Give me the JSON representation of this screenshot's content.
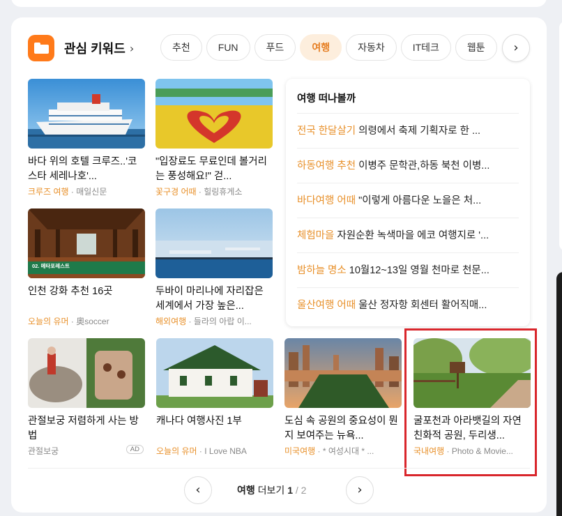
{
  "header": {
    "title": "관심 키워드",
    "chevron": "›"
  },
  "tabs": [
    {
      "label": "추천",
      "active": false
    },
    {
      "label": "FUN",
      "active": false
    },
    {
      "label": "푸드",
      "active": false
    },
    {
      "label": "여행",
      "active": true
    },
    {
      "label": "자동차",
      "active": false
    },
    {
      "label": "IT테크",
      "active": false
    },
    {
      "label": "웹툰",
      "active": false
    }
  ],
  "tabs_next": "›",
  "row1": [
    {
      "title": "바다 위의 호텔 크루즈..'코스타 세레나호'...",
      "keyword": "크루즈 여행",
      "source": "매일신문"
    },
    {
      "title": "\"입장료도 무료인데 볼거리는 풍성해요!\" 걷...",
      "keyword": "꽃구경 어때",
      "source": "힐링휴게소"
    }
  ],
  "row2": [
    {
      "title": "인천 강화 추천 16곳",
      "keyword": "오늘의 유머",
      "source": "奧soccer",
      "badge": "02. 메타포레스트"
    },
    {
      "title": "두바이 마리나에 자리잡은 세계에서 가장 높은...",
      "keyword": "해외여행",
      "source": "들라의 아랍 이..."
    }
  ],
  "travel_box": {
    "title": "여행 떠나볼까",
    "items": [
      {
        "keyword": "전국 한달살기",
        "text": "의령에서 축제 기획자로 한 ..."
      },
      {
        "keyword": "하동여행 추천",
        "text": "이병주 문학관,하동 북천 이병..."
      },
      {
        "keyword": "바다여행 어때",
        "text": "\"이렇게 아름다운 노을은 처..."
      },
      {
        "keyword": "체험마을",
        "text": "자원순환 녹색마을 에코 여행지로 '..."
      },
      {
        "keyword": "밤하늘 명소",
        "text": "10월12~13일 영월 천마로 천문..."
      },
      {
        "keyword": "울산여행 어때",
        "text": "울산 정자항 회센터 활어직매..."
      }
    ]
  },
  "row3": [
    {
      "title": "관절보궁 저렴하게 사는 방법",
      "keyword": "",
      "source": "관절보궁",
      "ad": "AD"
    },
    {
      "title": "캐나다 여행사진 1부",
      "keyword": "오늘의 유머",
      "source": "I Love NBA"
    },
    {
      "title": "도심 속 공원의 중요성이 뭔지 보여주는 뉴욕...",
      "keyword": "미국여행",
      "source": "* 여성시대 * ..."
    },
    {
      "title": "굴포천과 아라뱃길의 자연친화적 공원, 두리생...",
      "keyword": "국내여행",
      "source": "Photo & Movie..."
    }
  ],
  "pager": {
    "keyword": "여행",
    "label": "더보기",
    "current": "1",
    "total": "2",
    "prev": "‹",
    "next": "›"
  },
  "colors": {
    "accent": "#e8902a",
    "highlight": "#d9262c",
    "icon_bg": "#ff7a1a"
  }
}
